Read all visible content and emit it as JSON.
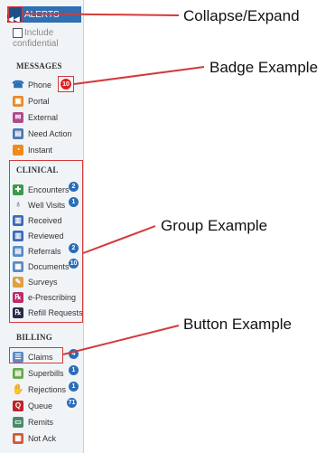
{
  "sidebar": {
    "alerts_label": "ALERTS",
    "collapse_icon": "|◀◀",
    "include_line1": "Include",
    "include_line2": "confidential",
    "sections": {
      "messages": "MESSAGES",
      "clinical": "CLINICAL",
      "billing": "BILLING"
    },
    "messages_items": [
      {
        "label": "Phone",
        "icon": "phone-icon",
        "badge": "10"
      },
      {
        "label": "Portal",
        "icon": "portal-icon"
      },
      {
        "label": "External",
        "icon": "external-icon"
      },
      {
        "label": "Need Action",
        "icon": "need-action-icon"
      },
      {
        "label": "Instant",
        "icon": "rss-icon"
      }
    ],
    "clinical_items": [
      {
        "label": "Encounters",
        "icon": "stethoscope-icon",
        "badge": "2"
      },
      {
        "label": "Well Visits",
        "icon": "well-visit-icon",
        "badge": "1"
      },
      {
        "label": "Received",
        "icon": "received-icon"
      },
      {
        "label": "Reviewed",
        "icon": "reviewed-icon"
      },
      {
        "label": "Referrals",
        "icon": "referrals-icon",
        "badge": "2"
      },
      {
        "label": "Documents",
        "icon": "documents-icon",
        "badge": "10"
      },
      {
        "label": "Surveys",
        "icon": "surveys-icon"
      },
      {
        "label": "e-Prescribing",
        "icon": "rx-icon"
      },
      {
        "label": "Refill Requests",
        "icon": "refill-icon"
      }
    ],
    "billing_items": [
      {
        "label": "Claims",
        "icon": "claims-icon",
        "badge": "4"
      },
      {
        "label": "Superbills",
        "icon": "superbills-icon",
        "badge": "1"
      },
      {
        "label": "Rejections",
        "icon": "rejections-icon",
        "badge": "1"
      },
      {
        "label": "Queue",
        "icon": "queue-icon",
        "badge": "71"
      },
      {
        "label": "Remits",
        "icon": "remits-icon"
      },
      {
        "label": "Not Ack",
        "icon": "not-ack-icon"
      }
    ]
  },
  "callouts": {
    "collapse": "Collapse/Expand",
    "badge": "Badge Example",
    "group": "Group Example",
    "button": "Button Example"
  },
  "colors": {
    "accent": "#2f6fb2",
    "badge_blue": "#2a6db8",
    "badge_red": "#e02020",
    "highlight_box": "#d33a3a"
  }
}
